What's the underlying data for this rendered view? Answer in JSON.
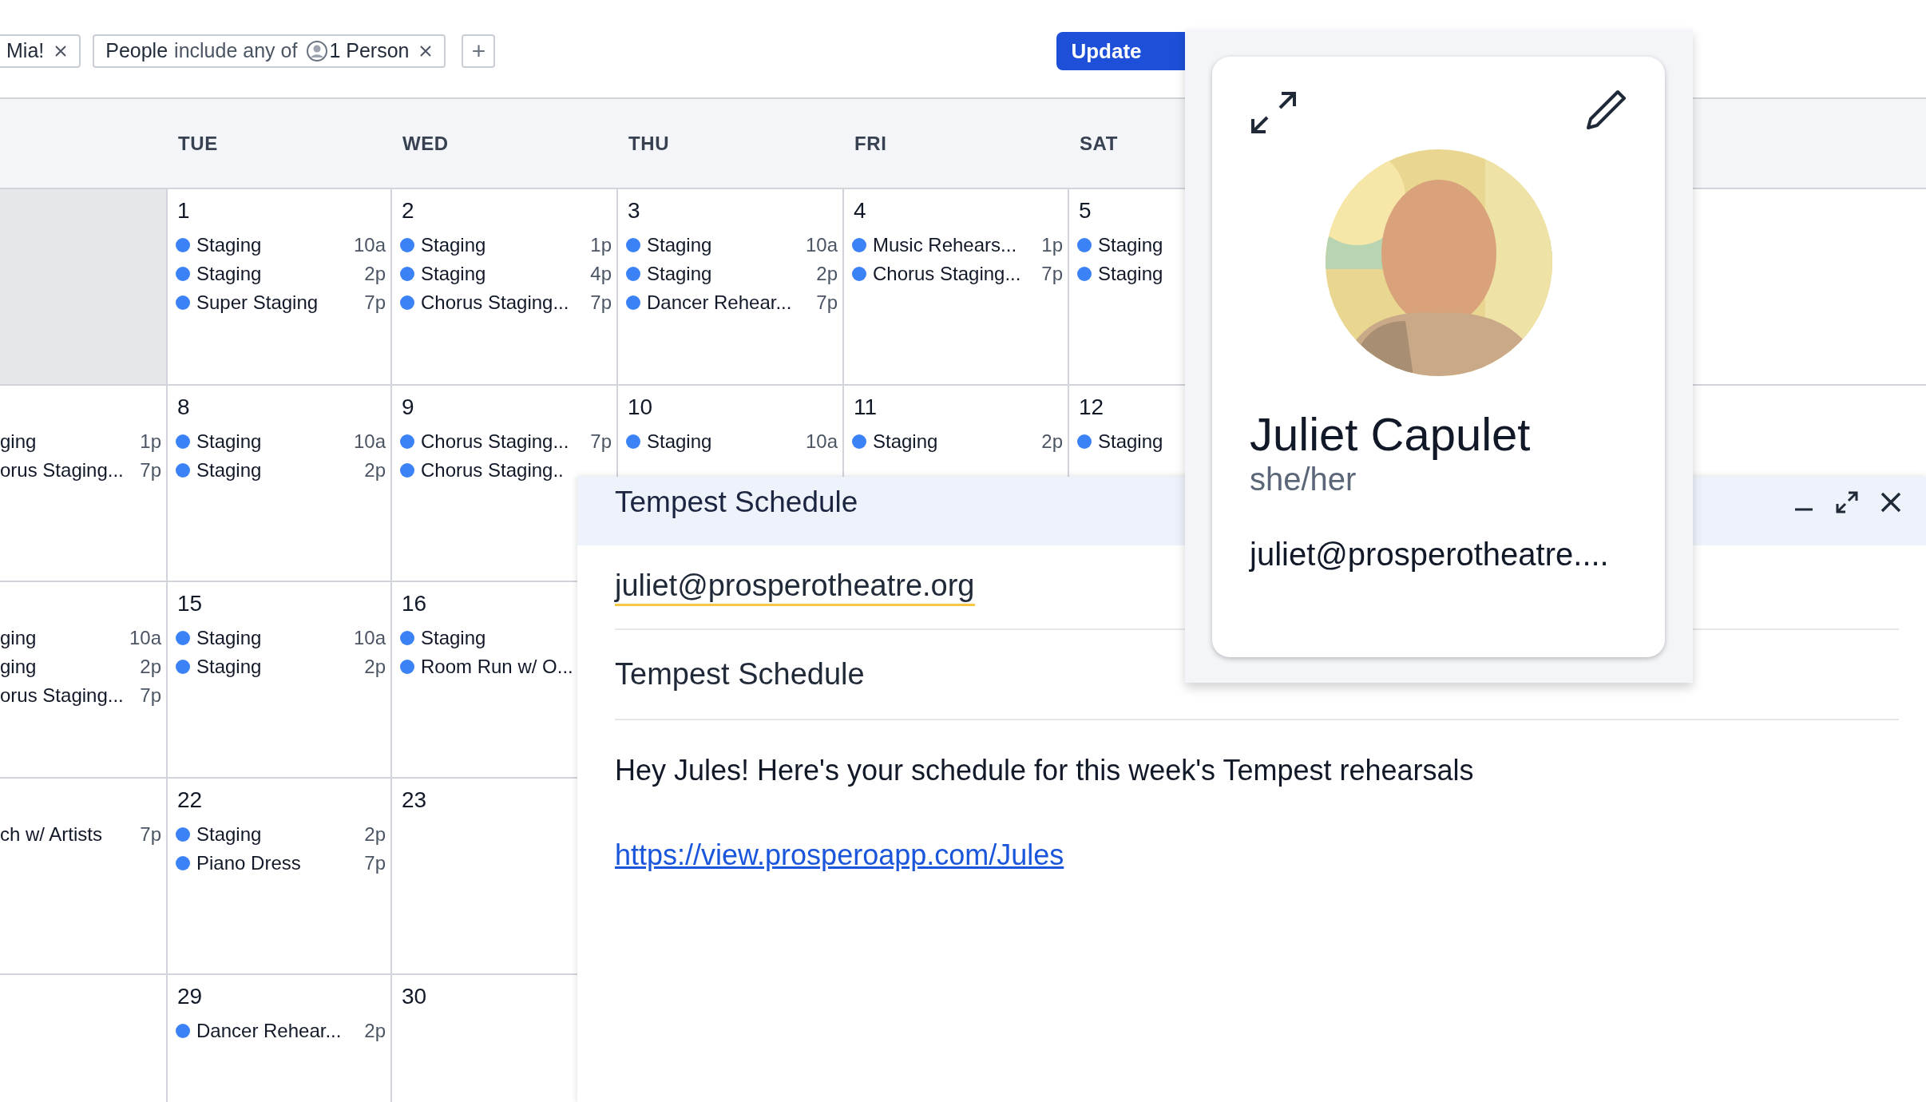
{
  "filters": [
    {
      "kind": "text",
      "label": "Mia!"
    },
    {
      "kind": "people",
      "field": "People",
      "operator": "include any of",
      "value": "1 Person"
    }
  ],
  "add_filter": "+",
  "update_button": "Update",
  "calendar": {
    "weekdays": [
      "TUE",
      "WED",
      "THU",
      "FRI",
      "SAT"
    ],
    "weeks": [
      {
        "days": [
          {
            "shaded": true
          },
          {
            "shaded": false,
            "date": "1",
            "events": [
              {
                "title": "Staging",
                "time": "10a"
              },
              {
                "title": "Staging",
                "time": "2p"
              },
              {
                "title": "Super Staging",
                "time": "7p"
              }
            ]
          },
          {
            "shaded": false,
            "date": "2",
            "events": [
              {
                "title": "Staging",
                "time": "1p"
              },
              {
                "title": "Staging",
                "time": "4p"
              },
              {
                "title": "Chorus Staging...",
                "time": "7p"
              }
            ]
          },
          {
            "shaded": false,
            "date": "3",
            "events": [
              {
                "title": "Staging",
                "time": "10a"
              },
              {
                "title": "Staging",
                "time": "2p"
              },
              {
                "title": "Dancer Rehear...",
                "time": "7p"
              }
            ]
          },
          {
            "shaded": false,
            "date": "4",
            "events": [
              {
                "title": "Music Rehears...",
                "time": "1p"
              },
              {
                "title": "Chorus Staging...",
                "time": "7p"
              }
            ]
          },
          {
            "shaded": false,
            "date": "5",
            "events": [
              {
                "title": "Staging"
              },
              {
                "title": "Staging"
              }
            ]
          }
        ]
      },
      {
        "days": [
          {
            "shaded": false,
            "events": [
              {
                "title": "ging",
                "time": "1p"
              },
              {
                "title": "orus Staging...",
                "time": "7p"
              }
            ]
          },
          {
            "shaded": false,
            "date": "8",
            "events": [
              {
                "title": "Staging",
                "time": "10a"
              },
              {
                "title": "Staging",
                "time": "2p"
              }
            ]
          },
          {
            "shaded": false,
            "date": "9",
            "events": [
              {
                "title": "Chorus Staging...",
                "time": "7p"
              },
              {
                "title": "Chorus Staging.."
              }
            ]
          },
          {
            "shaded": false,
            "date": "10",
            "events": [
              {
                "title": "Staging",
                "time": "10a"
              }
            ]
          },
          {
            "shaded": false,
            "date": "11",
            "events": [
              {
                "title": "Staging",
                "time": "2p"
              }
            ]
          },
          {
            "shaded": false,
            "date": "12",
            "events": [
              {
                "title": "Staging"
              }
            ]
          }
        ]
      },
      {
        "days": [
          {
            "shaded": false,
            "events": [
              {
                "title": "ging",
                "time": "10a"
              },
              {
                "title": "ging",
                "time": "2p"
              },
              {
                "title": "orus Staging...",
                "time": "7p"
              }
            ]
          },
          {
            "shaded": false,
            "date": "15",
            "events": [
              {
                "title": "Staging",
                "time": "10a"
              },
              {
                "title": "Staging",
                "time": "2p"
              }
            ]
          },
          {
            "shaded": false,
            "date": "16",
            "events": [
              {
                "title": "Staging"
              },
              {
                "title": "Room Run w/ O..."
              }
            ]
          }
        ]
      },
      {
        "days": [
          {
            "shaded": false,
            "events": [
              {
                "title": "ch w/ Artists",
                "time": "7p"
              }
            ]
          },
          {
            "shaded": false,
            "date": "22",
            "events": [
              {
                "title": "Staging",
                "time": "2p"
              },
              {
                "title": "Piano Dress",
                "time": "7p"
              }
            ]
          },
          {
            "shaded": false,
            "date": "23"
          }
        ]
      },
      {
        "days": [
          {
            "shaded": false
          },
          {
            "shaded": false,
            "date": "29",
            "events": [
              {
                "title": "Dancer Rehear...",
                "time": "2p"
              }
            ]
          },
          {
            "shaded": false,
            "date": "30"
          }
        ]
      }
    ]
  },
  "compose": {
    "title": "Tempest Schedule",
    "to": "juliet@prosperotheatre.org",
    "subject": "Tempest Schedule",
    "body": "Hey Jules! Here's your schedule for this week's Tempest rehearsals",
    "link": "https://view.prosperoapp.com/Jules"
  },
  "profile": {
    "name": "Juliet Capulet",
    "pronouns": "she/her",
    "email": "juliet@prosperotheatre...."
  }
}
